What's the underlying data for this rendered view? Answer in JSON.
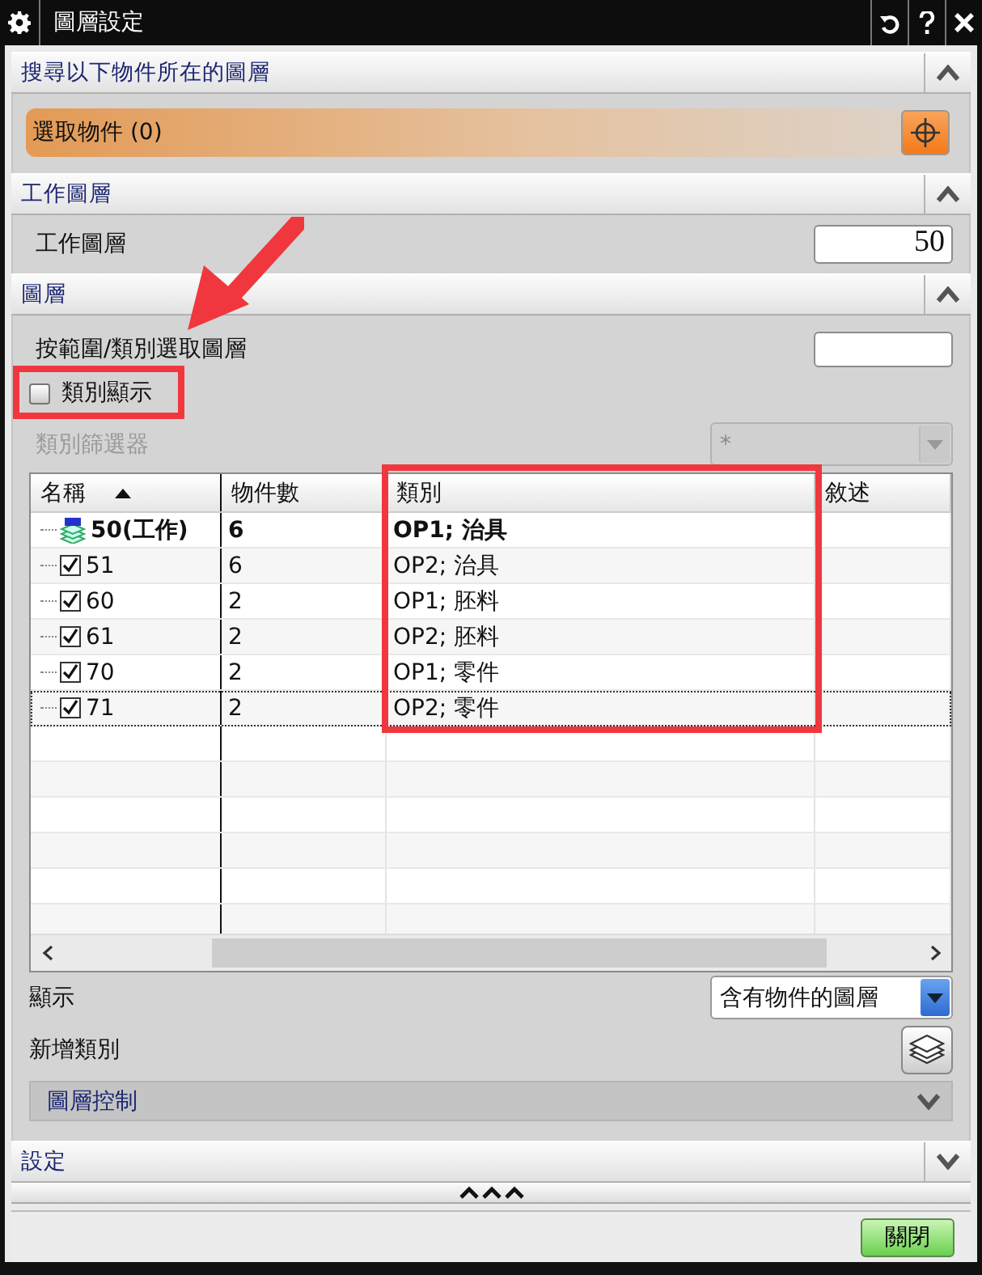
{
  "window": {
    "title": "圖層設定"
  },
  "find_section": {
    "title": "搜尋以下物件所在的圖層",
    "expanded": true,
    "select_label": "選取物件 (0)"
  },
  "work_layer_section": {
    "title": "工作圖層",
    "expanded": true,
    "label": "工作圖層",
    "value": "50"
  },
  "layers_section": {
    "title": "圖層",
    "expanded": true,
    "range_label": "按範圍/類別選取圖層",
    "category_display": {
      "label": "類別顯示",
      "checked": false
    },
    "category_filter": {
      "label": "類別篩選器",
      "value": "*",
      "disabled": true
    },
    "table": {
      "columns": [
        {
          "label": "名稱",
          "sorted": true
        },
        {
          "label": "物件數",
          "sorted": false
        },
        {
          "label": "類別",
          "sorted": false
        },
        {
          "label": "敘述",
          "sorted": false
        }
      ],
      "rows": [
        {
          "kind": "work",
          "name": "50(工作)",
          "count": "6",
          "category": "OP1; 治具",
          "focused": false
        },
        {
          "kind": "layer",
          "name": "51",
          "count": "6",
          "category": "OP2; 治具",
          "checked": true,
          "focused": false
        },
        {
          "kind": "layer",
          "name": "60",
          "count": "2",
          "category": "OP1; 胚料",
          "checked": true,
          "focused": false
        },
        {
          "kind": "layer",
          "name": "61",
          "count": "2",
          "category": "OP2; 胚料",
          "checked": true,
          "focused": false
        },
        {
          "kind": "layer",
          "name": "70",
          "count": "2",
          "category": "OP1; 零件",
          "checked": true,
          "focused": false
        },
        {
          "kind": "layer",
          "name": "71",
          "count": "2",
          "category": "OP2; 零件",
          "checked": true,
          "focused": true
        }
      ]
    },
    "show": {
      "label": "顯示",
      "value": "含有物件的圖層"
    },
    "add_category": {
      "label": "新增類別"
    },
    "layer_control": {
      "title": "圖層控制",
      "expanded": false
    }
  },
  "settings_section": {
    "title": "設定",
    "expanded": false
  },
  "buttons": [
    {
      "label": "關閉"
    }
  ]
}
